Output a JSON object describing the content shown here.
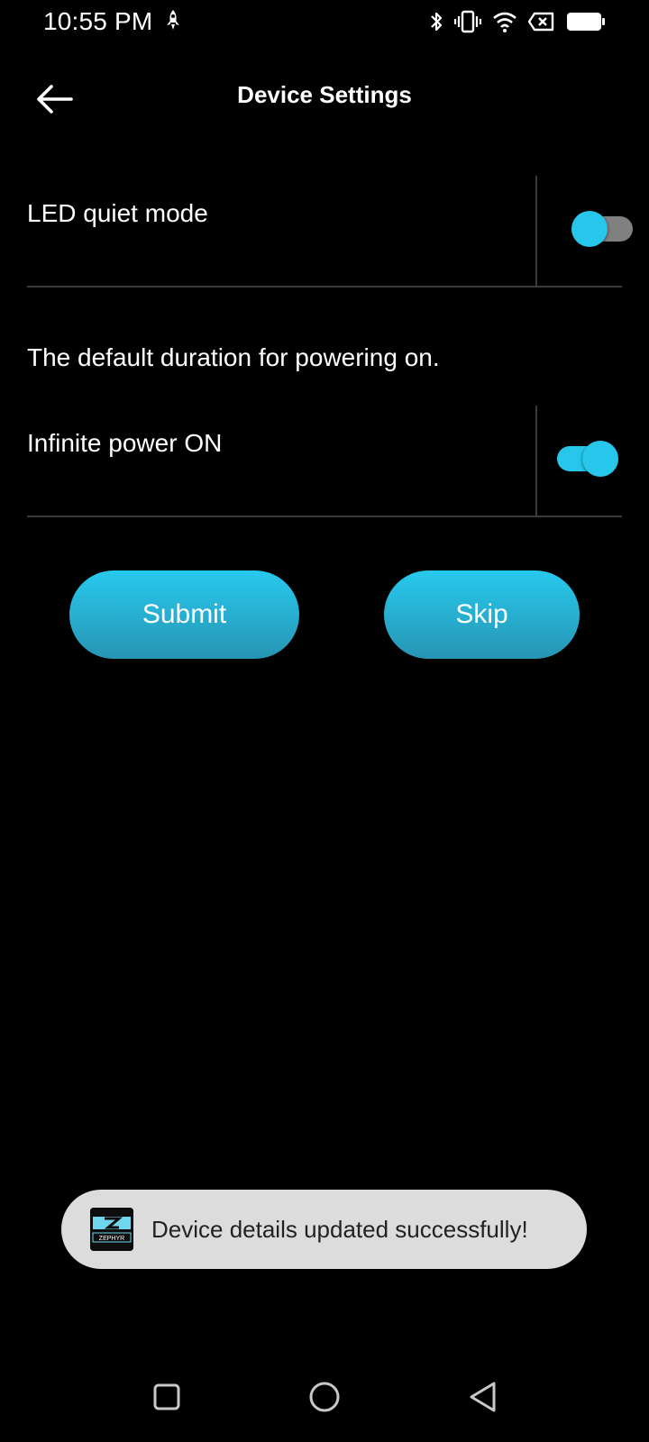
{
  "status_bar": {
    "time": "10:55 PM",
    "icons": [
      "rocket-icon",
      "bluetooth-icon",
      "vibrate-icon",
      "wifi-icon",
      "no-sim-icon",
      "battery-icon"
    ]
  },
  "header": {
    "back_icon": "arrow-left-icon",
    "title": "Device Settings"
  },
  "settings": {
    "led_quiet_mode": {
      "label": "LED quiet mode",
      "enabled": false
    },
    "power_section_description": "The default duration for powering on.",
    "infinite_power": {
      "label": "Infinite power ON",
      "enabled": true
    }
  },
  "actions": {
    "submit_label": "Submit",
    "skip_label": "Skip"
  },
  "toast": {
    "logo_text": "ZEPHYR",
    "message": "Device details updated successfully!"
  },
  "nav_bar": {
    "items": [
      "recents-square-icon",
      "home-circle-icon",
      "back-triangle-icon"
    ]
  },
  "colors": {
    "accent": "#27c7ec",
    "button_gradient_top": "#27c9ee",
    "button_gradient_bottom": "#2795b3",
    "toggle_off_track": "#808080",
    "background": "#000000",
    "toast_background": "#dcdcdc"
  }
}
